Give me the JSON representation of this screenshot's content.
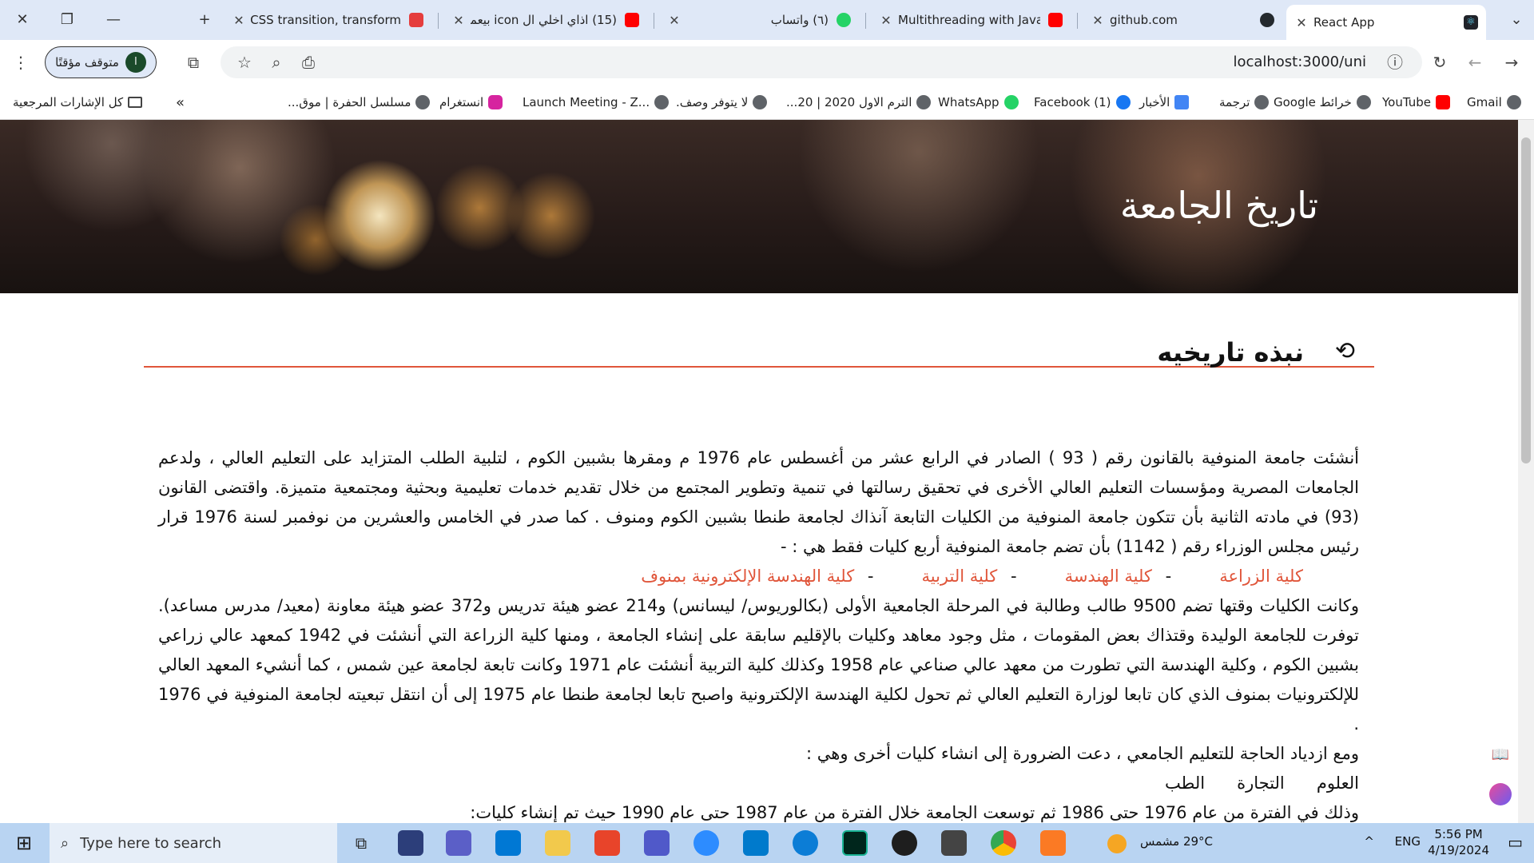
{
  "browser": {
    "tabs": [
      {
        "title": "React App",
        "active": true
      },
      {
        "title": "github.com"
      },
      {
        "title": "Multithreading with Java"
      },
      {
        "title": "(٦) واتساب"
      },
      {
        "title": "(15) اذاي اخلي ال icon بيعمل"
      },
      {
        "title": "CSS transition, transform,"
      }
    ],
    "url": "localhost:3000/uni",
    "profile_label": "متوقف مؤقتًا",
    "profile_initial": "ا",
    "bookmarks": [
      "Gmail",
      "YouTube",
      "خرائط Google",
      "ترجمة",
      "الأخبار",
      "Facebook (1)",
      "WhatsApp",
      "الترم الاول 2020 | 20...",
      "لا يتوفر وصف.",
      "Launch Meeting - Z...",
      "انستغرام",
      "مسلسل الحفرة | موق..."
    ],
    "all_bookmarks": "كل الإشارات المرجعية",
    "more": "»"
  },
  "page": {
    "hero_title": "تاريخ الجامعة",
    "section_title": "نبذه تاريخيه",
    "p1": "أنشئت جامعة المنوفية بالقانون رقم ( 93 ) الصادر في الرابع عشر من أغسطس عام 1976 م ومقرها بشبين الكوم ، لتلبية الطلب المتزايد على التعليم العالي ، ولدعم الجامعات المصرية ومؤسسات التعليم العالي الأخرى في تحقيق رسالتها في تنمية وتطوير المجتمع من خلال تقديم خدمات تعليمية وبحثية ومجتمعية متميزة. واقتضى القانون (93) في مادته الثانية بأن تتكون جامعة المنوفية من الكليات التابعة آنذاك لجامعة طنطا بشبين الكوم ومنوف . كما صدر في الخامس والعشرين من نوفمبر لسنة 1976 قرار رئيس مجلس الوزراء رقم ( 1142) بأن تضم جامعة المنوفية أربع كليات فقط هي : -",
    "faculties": [
      "كلية الزراعة",
      "كلية الهندسة",
      "كلية التربية",
      "كلية الهندسة الإلكترونية بمنوف"
    ],
    "p2": "وكانت الكليات وقتها تضم 9500 طالب وطالبة في المرحلة الجامعية الأولى (بكالوريوس/ ليسانس) و214 عضو هيئة تدريس و372 عضو هيئة معاونة (معيد/ مدرس مساعد). توفرت للجامعة الوليدة وقتذاك بعض المقومات ، مثل وجود معاهد وكليات بالإقليم سابقة على إنشاء الجامعة ، ومنها كلية الزراعة التي أنشئت في 1942 كمعهد عالي زراعي بشبين الكوم ، وكلية الهندسة التي تطورت من معهد عالي صناعي عام 1958 وكذلك كلية التربية أنشئت عام 1971 وكانت تابعة لجامعة عين شمس ، كما أنشيء المعهد العالي للإلكترونيات بمنوف الذي كان تابعا لوزارة التعليم العالي ثم تحول لكلية الهندسة الإلكترونية واصبح تابعا لجامعة طنطا عام 1975 إلى أن انتقل تبعيته لجامعة المنوفية في 1976 .",
    "p3": "ومع ازدياد الحاجة للتعليم الجامعي ، دعت الضرورة إلى انشاء كليات أخرى وهي :",
    "p4": "العلوم      التجارة      الطب",
    "p5": "وذلك في الفترة من عام 1976 حتى 1986 ثم توسعت الجامعة خلال الفترة من عام 1987 حتى عام 1990 حيث تم إنشاء كليات:"
  },
  "taskbar": {
    "search_placeholder": "Type here to search",
    "weather": "29°C  مشمس",
    "lang": "ENG",
    "time": "5:56 PM",
    "date": "4/19/2024"
  }
}
